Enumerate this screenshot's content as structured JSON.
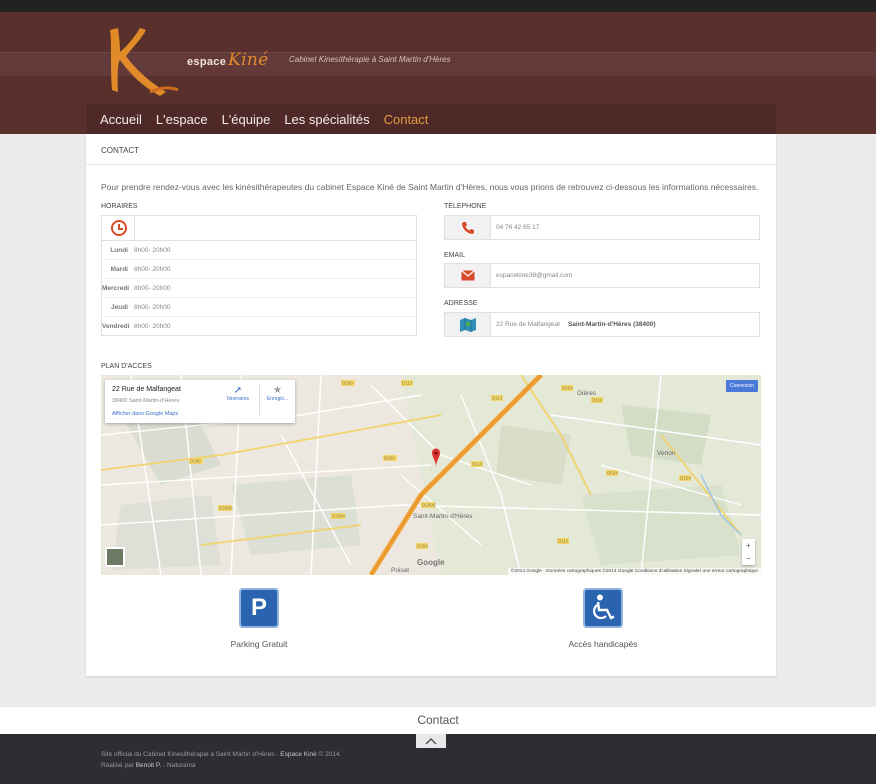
{
  "brand": {
    "logo_word_1": "espace",
    "logo_word_2": "Kiné",
    "tagline": "Cabinet Kinesithérapie à Saint Martin d'Hères",
    "accent_color": "#e39a3e",
    "header_color": "#5a302d"
  },
  "nav": {
    "items": [
      {
        "label": "Accueil"
      },
      {
        "label": "L'espace"
      },
      {
        "label": "L'équipe"
      },
      {
        "label": "Les spécialités"
      },
      {
        "label": "Contact"
      }
    ],
    "active": "Contact"
  },
  "page": {
    "title": "CONTACT",
    "intro": "Pour prendre rendez-vous avec les kinésithérapeutes du cabinet Espace Kiné de Saint Martin d'Hères,  nous vous prions de retrouvez ci-dessous les informations nécessaires."
  },
  "hours": {
    "label": "HORAIRES",
    "icon": "clock-icon",
    "rows": [
      {
        "day": "Lundi",
        "time": "8h00- 20h00"
      },
      {
        "day": "Mardi",
        "time": "8h00- 20h00"
      },
      {
        "day": "Mercredi",
        "time": "8h00- 20h00"
      },
      {
        "day": "Jeudi",
        "time": "8h00- 20h00"
      },
      {
        "day": "Vendredi",
        "time": "8h00- 20h00"
      }
    ]
  },
  "contact": {
    "phone_label": "TELEPHONE",
    "phone": "04 76 42 65 17",
    "email_label": "EMAIL",
    "email": "espacekine38@gmail.com",
    "address_label": "ADRESSE",
    "address_street": "22 Rue de Malfangeat",
    "address_city": "Saint-Martin-d'Hères (38400)"
  },
  "map": {
    "label": "PLAN D'ACCES",
    "card_title": "22 Rue de Malfangeat",
    "card_sub": "38400 Saint-Martin-d'Hères",
    "card_link": "Afficher dans Google Maps",
    "directions": "Itinéraires",
    "save": "Enregis...",
    "connexion": "Connexion",
    "attribution": "©2014 Google · Données cartographiques ©2014 Google   Conditions d'utilisation   Signaler une erreur cartographique",
    "google": "Google",
    "town": "Saint-Martin-d'Hères",
    "place_venon": "Venon",
    "place_gieres": "Gières",
    "place_poisat": "Poisat",
    "zoom_in": "+",
    "zoom_out": "−"
  },
  "amenities": [
    {
      "label": "Parking Gratuit",
      "icon": "parking-icon",
      "color": "#2a63b0"
    },
    {
      "label": "Accès handicapés",
      "icon": "wheelchair-icon",
      "color": "#2a63b0"
    }
  ],
  "footer": {
    "contact_title": "Contact",
    "line1_prefix": "Site official du Cabinet Kinesithérapie à Saint Martin d'Hères - ",
    "line1_brand": "Espace Kiné",
    "line1_suffix": " © 2014.",
    "line2_prefix": "Réalisé par ",
    "line2_author": "Benoit P.",
    "line2_suffix": " - Naturama"
  }
}
